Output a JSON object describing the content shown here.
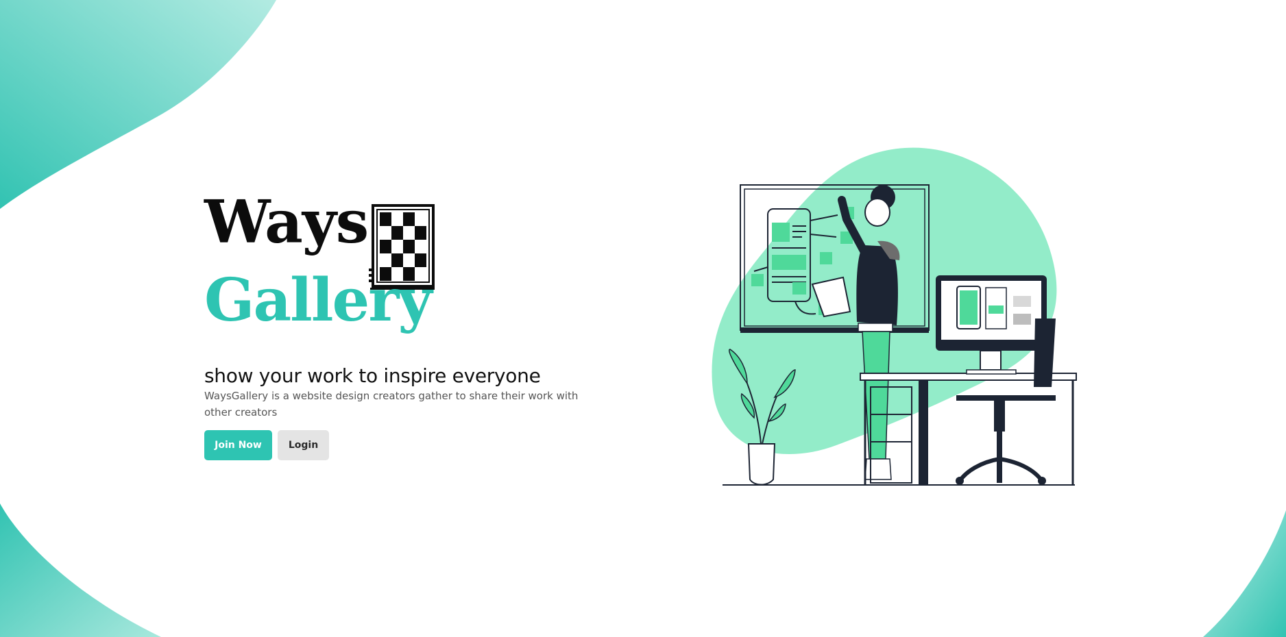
{
  "brand": {
    "word1": "Ways",
    "word2": "Gallery"
  },
  "hero": {
    "tagline": "show your work to inspire everyone",
    "description": "WaysGallery is a website design creators gather to share their work with other creators"
  },
  "actions": {
    "join_label": "Join Now",
    "login_label": "Login"
  },
  "colors": {
    "accent": "#2ec4b2",
    "illustration_blob": "#93ecc9",
    "illustration_green": "#4fd99a",
    "dark": "#1c2433"
  },
  "icons": {
    "logo_mark": "checkerboard-frame-icon",
    "illustration": "designer-at-whiteboard-illustration"
  }
}
